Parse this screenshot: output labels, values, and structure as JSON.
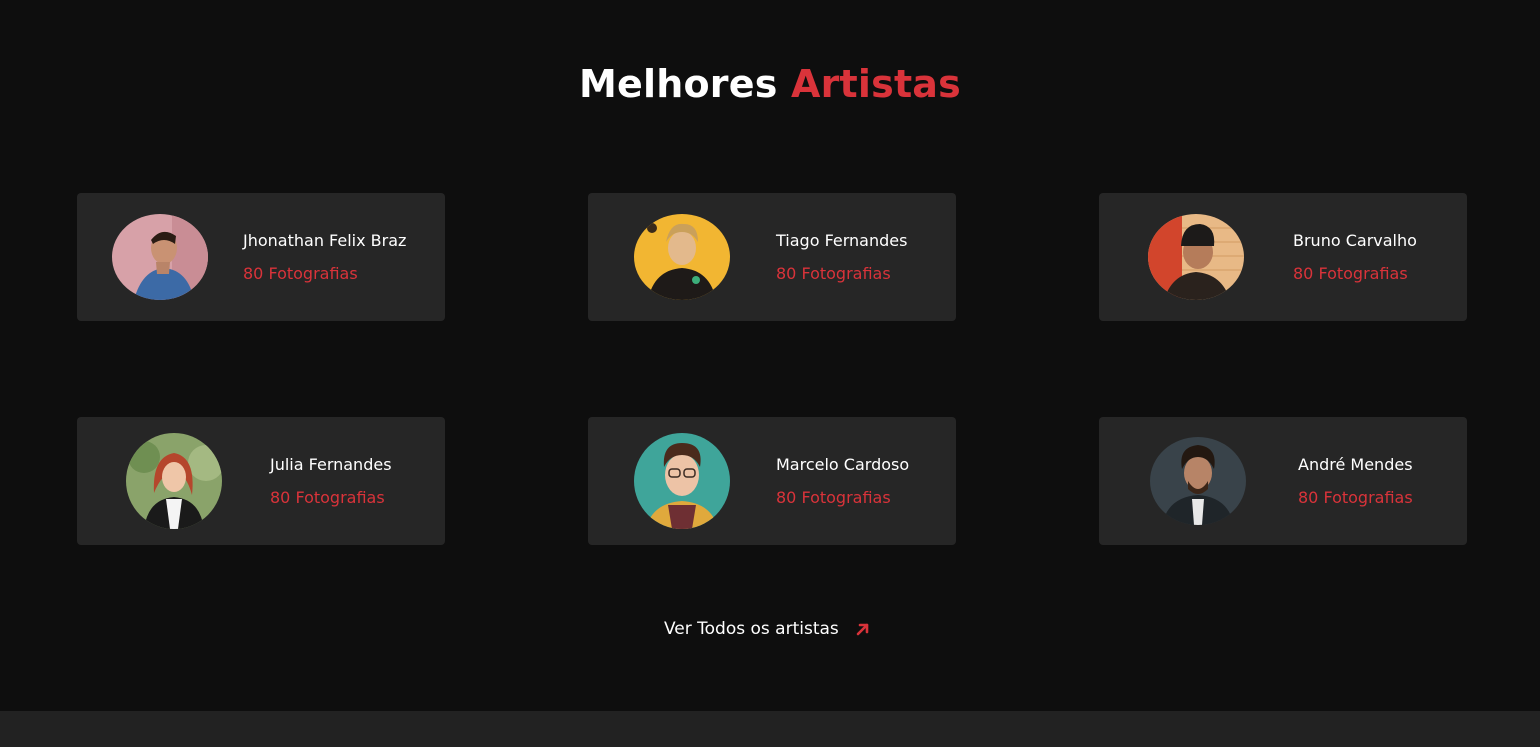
{
  "section": {
    "title_prefix": "Melhores",
    "title_accent": "Artistas"
  },
  "artists": [
    {
      "name": "Jhonathan Felix Braz",
      "count": "80 Fotografias",
      "avatar_icon": "artist-photo"
    },
    {
      "name": "Tiago Fernandes",
      "count": "80 Fotografias",
      "avatar_icon": "artist-photo"
    },
    {
      "name": "Bruno Carvalho",
      "count": "80 Fotografias",
      "avatar_icon": "artist-photo"
    },
    {
      "name": "Julia Fernandes",
      "count": "80 Fotografias",
      "avatar_icon": "artist-photo"
    },
    {
      "name": "Marcelo Cardoso",
      "count": "80 Fotografias",
      "avatar_icon": "artist-photo"
    },
    {
      "name": "André Mendes",
      "count": "80 Fotografias",
      "avatar_icon": "artist-photo"
    }
  ],
  "view_all": {
    "label": "Ver Todos os artistas",
    "icon": "arrow-up-right-icon"
  },
  "colors": {
    "accent": "#d9333a",
    "background": "#0e0e0e",
    "card": "#262626",
    "footer": "#222222"
  }
}
